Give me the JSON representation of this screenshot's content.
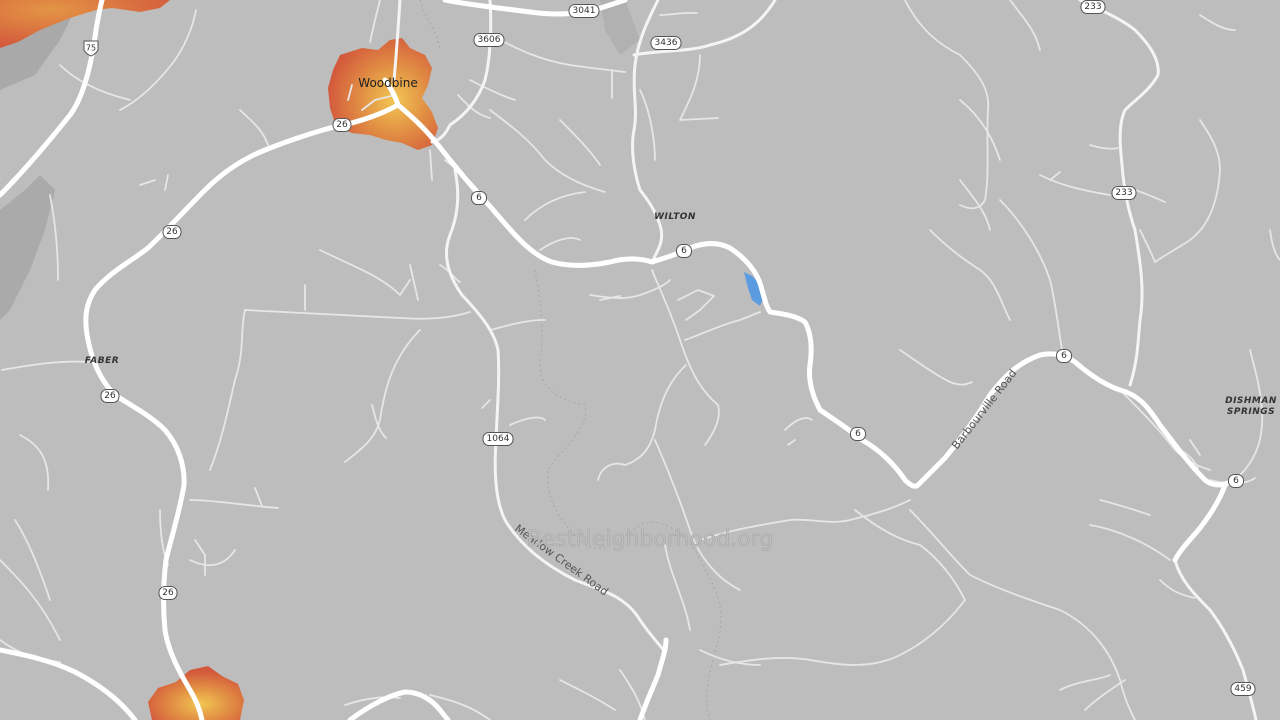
{
  "map": {
    "background": "#bdbdbd",
    "heat_colors": {
      "hot": "#f2c653",
      "mid": "#e39545",
      "cool": "#d3593c"
    },
    "water_color": "#5b9be0",
    "place_labels": {
      "woodbine": "Woodbine",
      "wilton": "WILTON",
      "faber": "FABER",
      "dishman_line1": "DISHMAN",
      "dishman_line2": "SPRINGS"
    },
    "road_names": {
      "meadow_creek": "Meadow Creek Road",
      "barbourville": "Barbourville Road"
    },
    "shields": {
      "i75": "75",
      "r3041": "3041",
      "r3606": "3606",
      "r3436": "3436",
      "r233_top": "233",
      "r233_mid": "233",
      "r26_woodbine": "26",
      "r26_a": "26",
      "r26_b": "26",
      "r26_c": "26",
      "r6_a": "6",
      "r6_wilton": "6",
      "r6_b": "6",
      "r6_c": "6",
      "r6_d": "6",
      "r1064": "1064",
      "r459": "459"
    },
    "watermark": "BestNeighborhood.org"
  }
}
